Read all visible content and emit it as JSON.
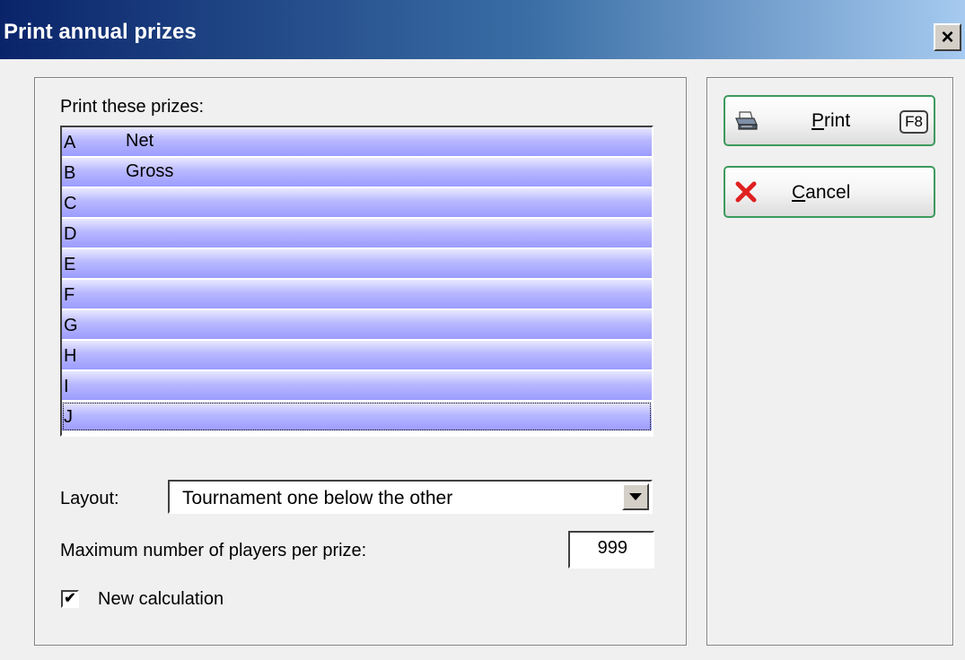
{
  "window": {
    "title": "Print annual prizes",
    "close_label": "×"
  },
  "prizes": {
    "label": "Print these prizes:",
    "items": [
      {
        "letter": "A",
        "name": "Net"
      },
      {
        "letter": "B",
        "name": "Gross"
      },
      {
        "letter": "C",
        "name": ""
      },
      {
        "letter": "D",
        "name": ""
      },
      {
        "letter": "E",
        "name": ""
      },
      {
        "letter": "F",
        "name": ""
      },
      {
        "letter": "G",
        "name": ""
      },
      {
        "letter": "H",
        "name": ""
      },
      {
        "letter": "I",
        "name": ""
      },
      {
        "letter": "J",
        "name": ""
      }
    ]
  },
  "layout": {
    "label": "Layout:",
    "selected": "Tournament one below the other"
  },
  "max_players": {
    "label": "Maximum number of players per prize:",
    "value": "999"
  },
  "new_calculation": {
    "label": "New calculation",
    "checked": true,
    "check_glyph": "✔"
  },
  "buttons": {
    "print": {
      "hotkey": "P",
      "rest": "rint",
      "key": "F8",
      "icon": "printer-icon"
    },
    "cancel": {
      "hotkey": "C",
      "rest": "ancel",
      "icon": "red-x-icon"
    }
  },
  "colors": {
    "title_gradient_start": "#0a246a",
    "row_blue": "#9c9cff",
    "button_border": "#3c9a5c",
    "cancel_icon": "#e02020"
  }
}
